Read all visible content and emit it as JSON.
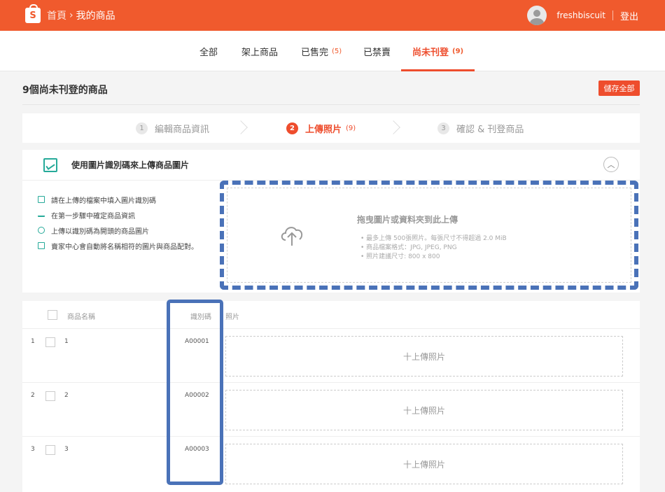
{
  "header": {
    "logo_letter": "S",
    "breadcrumb_home": "首頁",
    "breadcrumb_sep": "›",
    "breadcrumb_current": "我的商品",
    "username": "freshbiscuit",
    "logout": "登出",
    "color": "#f05a2d"
  },
  "tabs": [
    {
      "label": "全部",
      "count": ""
    },
    {
      "label": "架上商品",
      "count": ""
    },
    {
      "label": "已售完",
      "count": "(5)"
    },
    {
      "label": "已禁賣",
      "count": ""
    },
    {
      "label": "尚未刊登",
      "count": "(9)"
    }
  ],
  "page": {
    "title": "9個尚未刊登的商品",
    "save_all": "儲存全部"
  },
  "steps": [
    {
      "num": "1",
      "label": "編輯商品資訊",
      "count": ""
    },
    {
      "num": "2",
      "label": "上傳照片",
      "count": "(9)"
    },
    {
      "num": "3",
      "label": "確認 & 刊登商品",
      "count": ""
    }
  ],
  "panel": {
    "title": "使用圖片識別碼來上傳商品圖片",
    "collapse_icon": "chevron-up-icon",
    "tips": [
      "請在上傳的檔案中填入圖片識別碼",
      "在第一步驟中確定商品資訊",
      "上傳以識別碼為開頭的商品圖片",
      "賣家中心會自動將名稱相符的圖片與商品配對。"
    ],
    "drop_title": "拖曳圖片或資料夾到此上傳",
    "drop_rules": [
      "最多上傳 500張照片。每張尺寸不得超過 2.0 MiB",
      "商品檔案格式：JPG, JPEG, PNG",
      "照片建議尺寸: 800 x 800"
    ]
  },
  "table": {
    "col_name": "商品名稱",
    "col_code": "識別碼",
    "col_photo": "照片",
    "upload_label": "十上傳照片",
    "rows": [
      {
        "index": "1",
        "name": "1",
        "code": "A00001"
      },
      {
        "index": "2",
        "name": "2",
        "code": "A00002"
      },
      {
        "index": "3",
        "name": "3",
        "code": "A00003"
      }
    ]
  },
  "colors": {
    "accent": "#ee4d2d",
    "highlight": "#4a72b8",
    "teal": "#26aa99"
  }
}
